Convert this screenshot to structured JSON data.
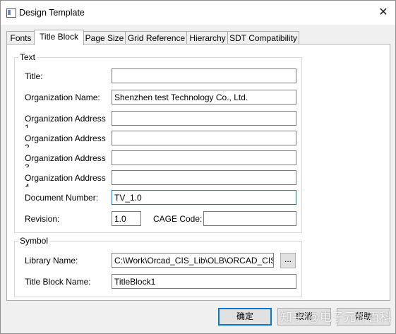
{
  "window": {
    "title": "Design Template",
    "close_label": "✕"
  },
  "tabs": [
    {
      "label": "Fonts"
    },
    {
      "label": "Title Block"
    },
    {
      "label": "Page Size"
    },
    {
      "label": "Grid Reference"
    },
    {
      "label": "Hierarchy"
    },
    {
      "label": "SDT Compatibility"
    }
  ],
  "active_tab": "Title Block",
  "text_group": {
    "title": "Text",
    "title_label": "Title:",
    "title_value": "",
    "org_name_label": "Organization Name:",
    "org_name_value": "Shenzhen test Technology Co., Ltd.",
    "org_address_label": "Organization Address",
    "org_address_1_value": "",
    "org_address_2_value": "",
    "org_address_3_value": "",
    "org_address_4_value": "",
    "doc_number_label": "Document Number:",
    "doc_number_value": "TV_1.0",
    "revision_label": "Revision:",
    "revision_value": "1.0",
    "cage_code_label": "CAGE Code:",
    "cage_code_value": ""
  },
  "symbol_group": {
    "title": "Symbol",
    "library_label": "Library Name:",
    "library_value": "C:\\Work\\Orcad_CIS_Lib\\OLB\\ORCAD_CIS_LI",
    "browse_label": "...",
    "title_block_label": "Title Block Name:",
    "title_block_value": "TitleBlock1"
  },
  "buttons": {
    "ok": "确定",
    "cancel": "取消",
    "help": "帮助"
  },
  "watermark": "知乎 @电子元件百科"
}
